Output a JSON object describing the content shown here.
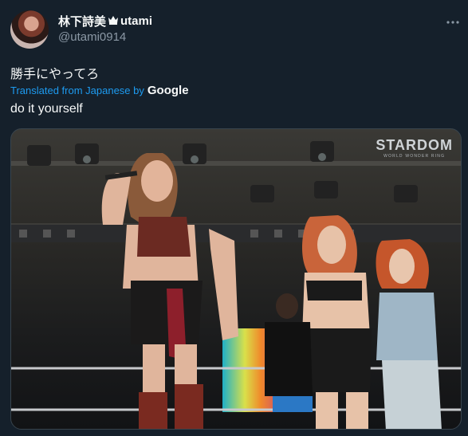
{
  "tweet": {
    "author_name": "林下詩美",
    "author_suffix": "utami",
    "crown_icon": "crown-emoji",
    "handle": "@utami0914",
    "text": "勝手にやってろ",
    "translated_label": "Translated from Japanese by",
    "translation_provider": "Google",
    "translation": "do it yourself"
  },
  "media": {
    "watermark": "STARDOM",
    "watermark_sub": "WORLD WONDER RING"
  },
  "colors": {
    "background": "#15202b",
    "link": "#1d9bf0",
    "secondary_text": "#8b98a5",
    "primary_text": "#f7f9f9"
  }
}
